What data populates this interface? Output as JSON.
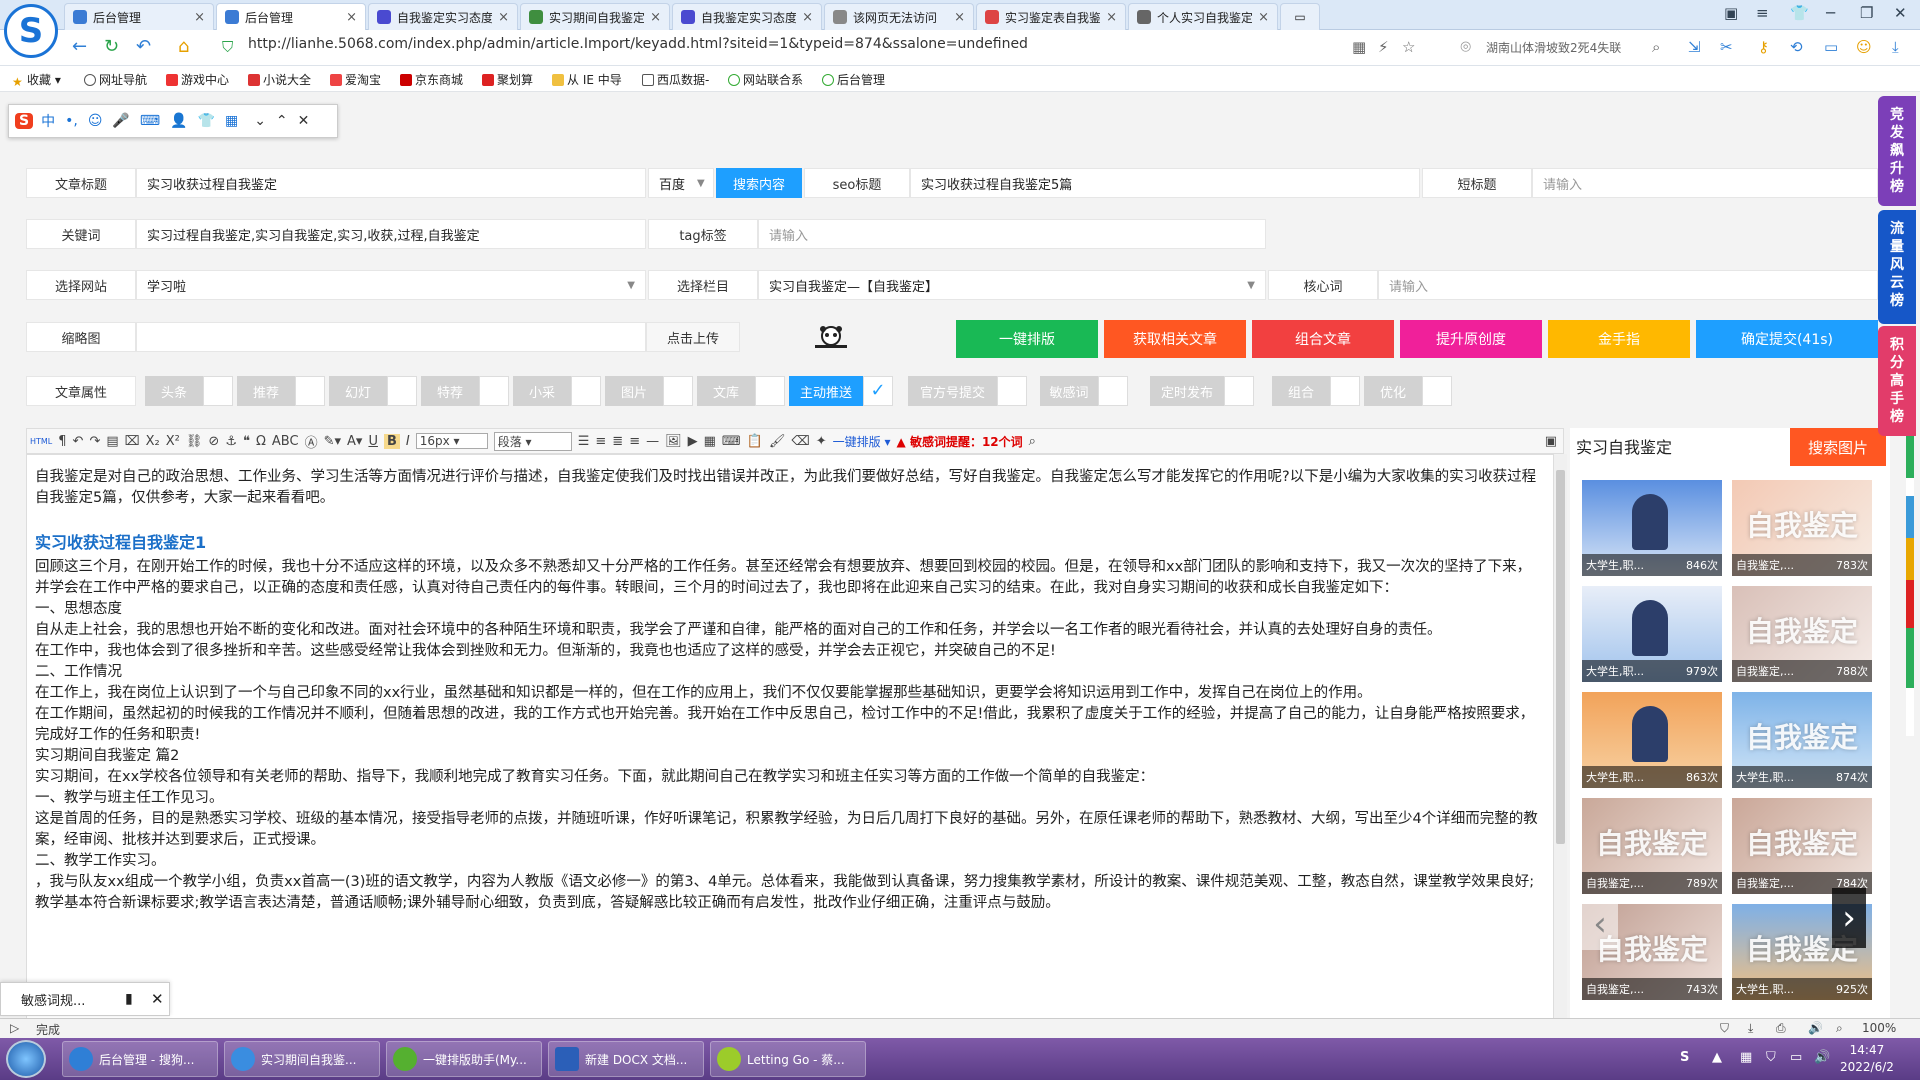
{
  "tabs": [
    {
      "label": "后台管理",
      "active": false
    },
    {
      "label": "后台管理",
      "active": true
    },
    {
      "label": "自我鉴定实习态度实习收获",
      "active": false
    },
    {
      "label": "实习期间自我鉴定（通用",
      "active": false
    },
    {
      "label": "自我鉴定实习态度怎么写",
      "active": false
    },
    {
      "label": "该网页无法访问",
      "active": false
    },
    {
      "label": "实习鉴定表自我鉴定（通",
      "active": false
    },
    {
      "label": "个人实习自我鉴定（精选",
      "active": false
    }
  ],
  "address": {
    "url": "http://lianhe.5068.com/index.php/admin/article.Import/keyadd.html?siteid=1&typeid=874&ssalone=undefined",
    "news": "湖南山体滑坡致2死4失联"
  },
  "bookmarks": [
    "收藏",
    "网址导航",
    "游戏中心",
    "小说大全",
    "爱淘宝",
    "京东商城",
    "聚划算",
    "从 IE 中导",
    "西瓜数据-",
    "网站联合系",
    "后台管理"
  ],
  "form": {
    "title_label": "文章标题",
    "title_value": "实习收获过程自我鉴定",
    "engine": "百度",
    "search_btn": "搜索内容",
    "seo_label": "seo标题",
    "seo_value": "实习收获过程自我鉴定5篇",
    "short_label": "短标题",
    "short_ph": "请输入",
    "kw_label": "关键词",
    "kw_value": "实习过程自我鉴定,实习自我鉴定,实习,收获,过程,自我鉴定",
    "tag_label": "tag标签",
    "tag_ph": "请输入",
    "site_label": "选择网站",
    "site_value": "学习啦",
    "col_label": "选择栏目",
    "col_value": "实习自我鉴定—【自我鉴定】",
    "core_label": "核心词",
    "core_ph": "请输入",
    "thumb_label": "缩略图",
    "upload_btn": "点击上传",
    "attr_label": "文章属性"
  },
  "actions": [
    {
      "label": "一键排版",
      "color": "#19b955"
    },
    {
      "label": "获取相关文章",
      "color": "#ff5722"
    },
    {
      "label": "组合文章",
      "color": "#f24040"
    },
    {
      "label": "提升原创度",
      "color": "#f0209a"
    },
    {
      "label": "金手指",
      "color": "#ffb800"
    },
    {
      "label": "确定提交(41s)",
      "color": "#1e9fff"
    }
  ],
  "attributes": [
    {
      "label": "头条",
      "on": false
    },
    {
      "label": "推荐",
      "on": false
    },
    {
      "label": "幻灯",
      "on": false
    },
    {
      "label": "特荐",
      "on": false
    },
    {
      "label": "小采",
      "on": false
    },
    {
      "label": "图片",
      "on": false
    },
    {
      "label": "文库",
      "on": false
    },
    {
      "label": "主动推送",
      "on": true
    },
    {
      "label": "官方号提交",
      "on": false
    },
    {
      "label": "敏感词",
      "on": false
    },
    {
      "label": "定时发布",
      "on": false
    },
    {
      "label": "组合",
      "on": false
    },
    {
      "label": "优化",
      "on": false
    }
  ],
  "toolbar": {
    "font_size": "16px",
    "paragraph": "段落",
    "layout": "一键排版",
    "sensitive": "敏感词提醒：12个词"
  },
  "editor": [
    {
      "t": "p",
      "text": "自我鉴定是对自己的政治思想、工作业务、学习生活等方面情况进行评价与描述，自我鉴定使我们及时找出错误并改正，为此我们要做好总结，写好自我鉴定。自我鉴定怎么写才能发挥它的作用呢?以下是小编为大家收集的实习收获过程自我鉴定5篇，仅供参考，大家一起来看看吧。"
    },
    {
      "t": "h",
      "text": "实习收获过程自我鉴定1"
    },
    {
      "t": "p",
      "text": "回顾这三个月，在刚开始工作的时候，我也十分不适应这样的环境，以及众多不熟悉却又十分严格的工作任务。甚至还经常会有想要放弃、想要回到校园的校园。但是，在领导和xx部门团队的影响和支持下，我又一次次的坚持了下来，并学会在工作中严格的要求自己，以正确的态度和责任感，认真对待自己责任内的每件事。转眼间，三个月的时间过去了，我也即将在此迎来自己实习的结束。在此，我对自身实习期间的收获和成长自我鉴定如下："
    },
    {
      "t": "p",
      "text": "一、思想态度"
    },
    {
      "t": "p",
      "text": "自从走上社会，我的思想也开始不断的变化和改进。面对社会环境中的各种陌生环境和职责，我学会了严谨和自律，能严格的面对自己的工作和任务，并学会以一名工作者的眼光看待社会，并认真的去处理好自身的责任。"
    },
    {
      "t": "p",
      "text": "在工作中，我也体会到了很多挫折和辛苦。这些感受经常让我体会到挫败和无力。但渐渐的，我竟也也适应了这样的感受，并学会去正视它，并突破自己的不足!"
    },
    {
      "t": "p",
      "text": "二、工作情况"
    },
    {
      "t": "p",
      "text": "在工作上，我在岗位上认识到了一个与自己印象不同的xx行业，虽然基础和知识都是一样的，但在工作的应用上，我们不仅仅要能掌握那些基础知识，更要学会将知识运用到工作中，发挥自己在岗位上的作用。"
    },
    {
      "t": "p",
      "text": "在工作期间，虽然起初的时候我的工作情况并不顺利，但随着思想的改进，我的工作方式也开始完善。我开始在工作中反思自己，检讨工作中的不足!借此，我累积了虚度关于工作的经验，并提高了自己的能力，让自身能严格按照要求，完成好工作的任务和职责!"
    },
    {
      "t": "p",
      "text": "实习期间自我鉴定 篇2"
    },
    {
      "t": "p",
      "text": "实习期间，在xx学校各位领导和有关老师的帮助、指导下，我顺利地完成了教育实习任务。下面，就此期间自己在教学实习和班主任实习等方面的工作做一个简单的自我鉴定："
    },
    {
      "t": "p",
      "text": "一、教学与班主任工作见习。"
    },
    {
      "t": "p",
      "text": "这是首周的任务，目的是熟悉实习学校、班级的基本情况，接受指导老师的点拨，并随班听课，作好听课笔记，积累教学经验，为日后几周打下良好的基础。另外，在原任课老师的帮助下，熟悉教材、大纲，写出至少4个详细而完整的教案，经审阅、批核并达到要求后，正式授课。"
    },
    {
      "t": "p",
      "text": "二、教学工作实习。"
    },
    {
      "t": "p",
      "text": "，我与队友xx组成一个教学小组，负责xx首高一(3)班的语文教学，内容为人教版《语文必修一》的第3、4单元。总体看来，我能做到认真备课，努力搜集教学素材，所设计的教案、课件规范美观、工整，教态自然，课堂教学效果良好;教学基本符合新课标要求;教学语言表达清楚，普通话顺畅;课外辅导耐心细致，负责到底，答疑解惑比较正确而有启发性，批改作业仔细正确，注重评点与鼓励。"
    }
  ],
  "sidebar": {
    "title": "实习自我鉴定",
    "search_btn": "搜索图片",
    "thumbs": [
      {
        "cap": "大学生,职...",
        "count": "846次"
      },
      {
        "cap": "自我鉴定,...",
        "count": "783次"
      },
      {
        "cap": "大学生,职...",
        "count": "979次"
      },
      {
        "cap": "自我鉴定,...",
        "count": "788次"
      },
      {
        "cap": "大学生,职...",
        "count": "863次"
      },
      {
        "cap": "大学生,职...",
        "count": "874次"
      },
      {
        "cap": "自我鉴定,...",
        "count": "789次"
      },
      {
        "cap": "自我鉴定,...",
        "count": "784次"
      },
      {
        "cap": "自我鉴定,...",
        "count": "743次"
      },
      {
        "cap": "大学生,职...",
        "count": "925次"
      }
    ]
  },
  "right_tags": [
    {
      "label": "竞发飙升榜",
      "color": "#7c3fb8"
    },
    {
      "label": "流量风云榜",
      "color": "#1657c8"
    },
    {
      "label": "积分高手榜",
      "color": "#e23c6a"
    }
  ],
  "sensitive_popup": "敏感词规...",
  "status": {
    "text": "完成",
    "zoom": "100%"
  },
  "taskbar": [
    {
      "label": "后台管理 - 搜狗...",
      "color": "#2f7fd6"
    },
    {
      "label": "实习期间自我鉴...",
      "color": "#3a8de0"
    },
    {
      "label": "一键排版助手(My...",
      "color": "#55b030"
    },
    {
      "label": "新建 DOCX 文档...",
      "color": "#2b5fb8"
    },
    {
      "label": "Letting Go - 蔡...",
      "color": "#9ccc2a"
    }
  ],
  "clock": {
    "time": "14:47",
    "date": "2022/6/2"
  },
  "image_watermark": "自我鉴定"
}
